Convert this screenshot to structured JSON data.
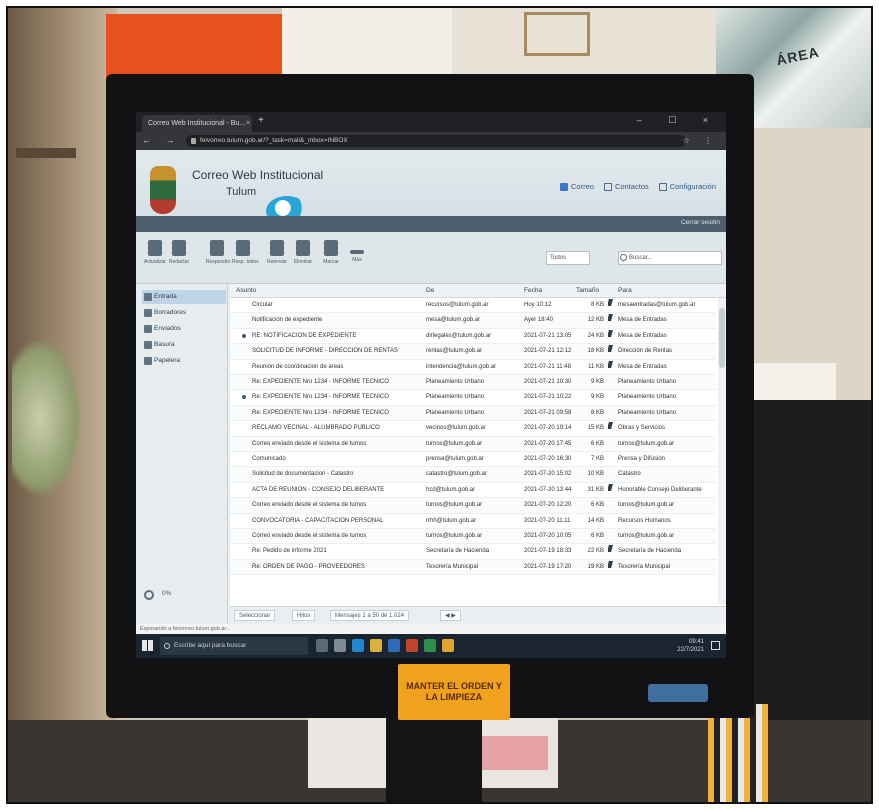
{
  "browser": {
    "tab_title": "Correo Web Institucional - Bu...",
    "tab_close": "×",
    "new_tab": "+",
    "window_controls": "– ☐ ×",
    "nav_buttons": "← → C",
    "url": "feivorreo.tulum.gob.ar/?_task=mail&_mbox=INBOX",
    "addr_icons": "☆ ⋮"
  },
  "app": {
    "title": "Correo Web Institucional",
    "subtitle": "Tulum",
    "links": [
      {
        "label": "Correo",
        "icon": "mail-icon"
      },
      {
        "label": "Contactos",
        "icon": "contacts-icon"
      },
      {
        "label": "Configuración",
        "icon": "settings-icon"
      }
    ],
    "user": "Cerrar sesión"
  },
  "toolbar": {
    "buttons": [
      "Actualizar",
      "Redactar",
      "Responder",
      "Resp. todos",
      "Reenviar",
      "Eliminar",
      "Marcar",
      "Más"
    ],
    "filter": "Todos",
    "search_placeholder": "Buscar..."
  },
  "folders": [
    {
      "name": "Entrada",
      "icon": "inbox-icon",
      "selected": true
    },
    {
      "name": "Borradores",
      "icon": "drafts-icon"
    },
    {
      "name": "Enviados",
      "icon": "sent-icon"
    },
    {
      "name": "Basura",
      "icon": "junk-icon"
    },
    {
      "name": "Papelera",
      "icon": "trash-icon"
    }
  ],
  "sidebar_quota": "0%",
  "list": {
    "headers": [
      "Asunto",
      "De",
      "Fecha",
      "Tamaño",
      "Para"
    ],
    "rows": [
      {
        "subject": "Circular",
        "from": "recursos@tulum.gob.ar",
        "date": "Hoy 10:12",
        "size": "8 KB",
        "flag": true,
        "to": "mesaentradas@tulum.gob.ar"
      },
      {
        "subject": "Notificación de expediente",
        "from": "mesa@tulum.gob.ar",
        "date": "Ayer 18:40",
        "size": "12 KB",
        "flag": true,
        "to": "Mesa de Entradas"
      },
      {
        "subject": "RE: NOTIFICACION DE EXPEDIENTE",
        "from": "dirlegales@tulum.gob.ar",
        "date": "2021-07-21 13:05",
        "size": "24 KB",
        "flag": true,
        "to": "Mesa de Entradas"
      },
      {
        "subject": "SOLICITUD DE INFORME - DIRECCION DE RENTAS",
        "from": "rentas@tulum.gob.ar",
        "date": "2021-07-21 12:12",
        "size": "18 KB",
        "flag": true,
        "to": "Dirección de Rentas"
      },
      {
        "subject": "Reunion de coordinacion de areas",
        "from": "intendencia@tulum.gob.ar",
        "date": "2021-07-21 11:48",
        "size": "11 KB",
        "flag": true,
        "to": "Mesa de Entradas"
      },
      {
        "subject": "Re: EXPEDIENTE Nro 1234 - INFORME TECNICO",
        "from": "Planeamiento Urbano",
        "date": "2021-07-21 10:30",
        "size": "9 KB",
        "flag": false,
        "to": "Planeamiento Urbano"
      },
      {
        "subject": "Re: EXPEDIENTE Nro 1234 - INFORME TECNICO",
        "from": "Planeamiento Urbano",
        "date": "2021-07-21 10:22",
        "size": "9 KB",
        "flag": false,
        "to": "Planeamiento Urbano"
      },
      {
        "subject": "Re: EXPEDIENTE Nro 1234 - INFORME TECNICO",
        "from": "Planeamiento Urbano",
        "date": "2021-07-21 09:58",
        "size": "8 KB",
        "flag": false,
        "to": "Planeamiento Urbano"
      },
      {
        "subject": "RECLAMO VECINAL - ALUMBRADO PUBLICO",
        "from": "vecinos@tulum.gob.ar",
        "date": "2021-07-20 19:14",
        "size": "15 KB",
        "flag": true,
        "to": "Obras y Servicios"
      },
      {
        "subject": "Correo enviado desde el sistema de turnos",
        "from": "turnos@tulum.gob.ar",
        "date": "2021-07-20 17:45",
        "size": "6 KB",
        "flag": false,
        "to": "turnos@tulum.gob.ar"
      },
      {
        "subject": "Comunicado",
        "from": "prensa@tulum.gob.ar",
        "date": "2021-07-20 16:30",
        "size": "7 KB",
        "flag": false,
        "to": "Prensa y Difusión"
      },
      {
        "subject": "Solicitud de documentacion - Catastro",
        "from": "catastro@tulum.gob.ar",
        "date": "2021-07-20 15:02",
        "size": "10 KB",
        "flag": false,
        "to": "Catastro"
      },
      {
        "subject": "ACTA DE REUNION - CONSEJO DELIBERANTE",
        "from": "hcd@tulum.gob.ar",
        "date": "2021-07-20 13:44",
        "size": "31 KB",
        "flag": true,
        "to": "Honorable Consejo Deliberante"
      },
      {
        "subject": "Correo enviado desde el sistema de turnos",
        "from": "turnos@tulum.gob.ar",
        "date": "2021-07-20 12:20",
        "size": "6 KB",
        "flag": false,
        "to": "turnos@tulum.gob.ar"
      },
      {
        "subject": "CONVOCATORIA - CAPACITACION PERSONAL",
        "from": "rrhh@tulum.gob.ar",
        "date": "2021-07-20 11:11",
        "size": "14 KB",
        "flag": false,
        "to": "Recursos Humanos"
      },
      {
        "subject": "Correo enviado desde el sistema de turnos",
        "from": "turnos@tulum.gob.ar",
        "date": "2021-07-20 10:05",
        "size": "6 KB",
        "flag": false,
        "to": "turnos@tulum.gob.ar"
      },
      {
        "subject": "Re: Pedido de informe 2021",
        "from": "Secretaría de Hacienda",
        "date": "2021-07-19 18:33",
        "size": "22 KB",
        "flag": true,
        "to": "Secretaría de Hacienda"
      },
      {
        "subject": "Re: ORDEN DE PAGO - PROVEEDORES",
        "from": "Tesorería Municipal",
        "date": "2021-07-19 17:20",
        "size": "19 KB",
        "flag": true,
        "to": "Tesorería Municipal"
      }
    ]
  },
  "list_footer": {
    "select": "Seleccionar",
    "threads": "Hilos",
    "pager": "Mensajes 1 a 50 de 1.024",
    "nav": "◀ ▶"
  },
  "statusbar": "Esperando a feivorreo.tulum.gob.ar...",
  "taskbar": {
    "search_placeholder": "Escribe aquí para buscar",
    "time": "09:41",
    "date": "22/7/2021"
  },
  "sticker": {
    "line1": "MANTER EL ORDEN Y",
    "line2": "LA LIMPIEZA"
  },
  "poster": "ÁREA",
  "colors": {
    "accent": "#3d74c7",
    "header_bar": "#4c5e6b",
    "sticker": "#f0a21f",
    "curtain": "#e8501d"
  }
}
